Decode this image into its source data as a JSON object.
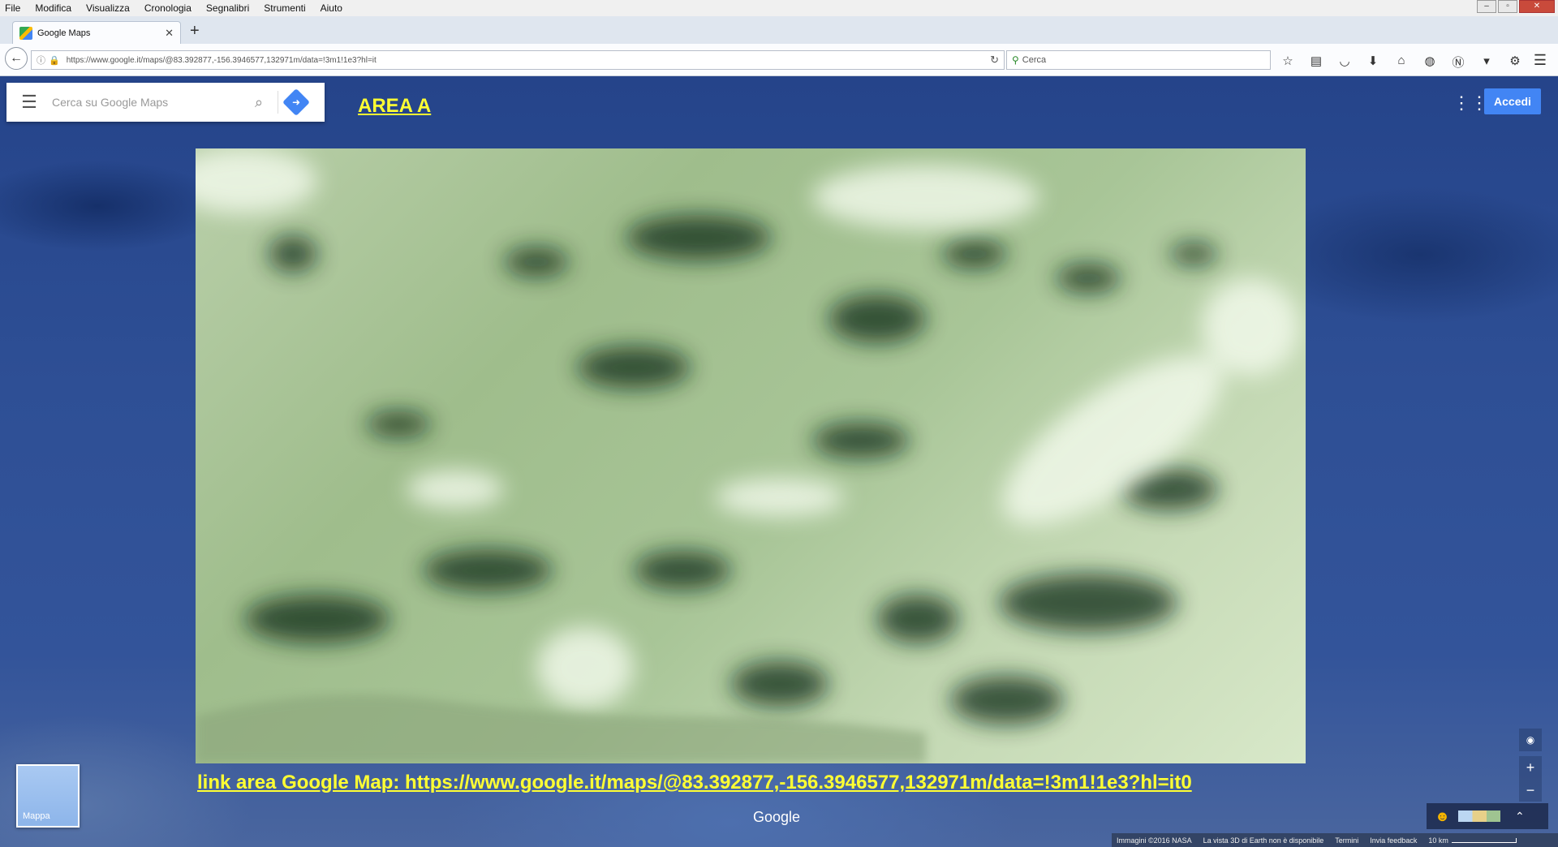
{
  "browser": {
    "menu": [
      "File",
      "Modifica",
      "Visualizza",
      "Cronologia",
      "Segnalibri",
      "Strumenti",
      "Aiuto"
    ],
    "tab_title": "Google Maps",
    "new_tab": "+",
    "url": "https://www.google.it/maps/@83.392877,-156.3946577,132971m/data=!3m1!1e3?hl=it",
    "search_placeholder": "Cerca",
    "toolbar_icons": [
      "star-icon",
      "reading-list-icon",
      "pocket-icon",
      "download-icon",
      "home-icon",
      "chat-icon",
      "n-extension-icon",
      "dropdown-icon",
      "addon-icon"
    ]
  },
  "maps": {
    "search_placeholder": "Cerca su Google Maps",
    "signin_label": "Accedi",
    "thumbnail_label": "Mappa",
    "logo": "Google"
  },
  "overlay": {
    "title": "AREA A",
    "link_caption": "link area Google Map: https://www.google.it/maps/@83.392877,-156.3946577,132971m/data=!3m1!1e3?hl=it0"
  },
  "footer": {
    "imagery": "Immagini ©2016 NASA",
    "notice": "La vista 3D di Earth non è disponibile",
    "terms": "Termini",
    "feedback": "Invia feedback",
    "scale": "10 km"
  },
  "colors": {
    "overlay_text": "#ffff33",
    "accent": "#4285f4"
  }
}
